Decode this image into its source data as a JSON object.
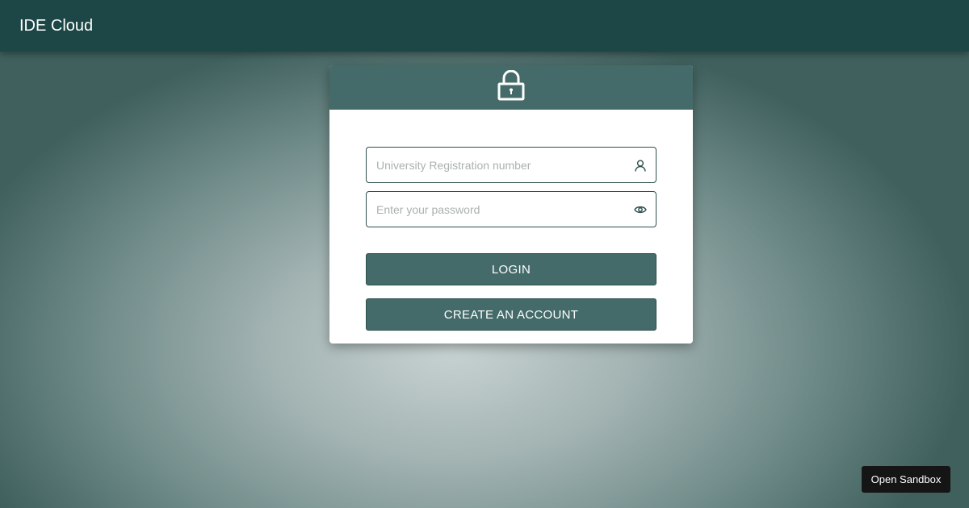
{
  "header": {
    "title": "IDE Cloud"
  },
  "login_card": {
    "header_icon": "lock-icon",
    "username": {
      "value": "",
      "placeholder": "University Registration number",
      "icon": "user-icon"
    },
    "password": {
      "value": "",
      "placeholder": "Enter your password",
      "icon": "eye-icon"
    },
    "login_label": "LOGIN",
    "create_account_label": "CREATE AN ACCOUNT"
  },
  "sandbox": {
    "label": "Open Sandbox"
  },
  "colors": {
    "topbar": "#1c4746",
    "card_header": "#446b69",
    "button": "#446b69",
    "sandbox_button": "#151515"
  }
}
